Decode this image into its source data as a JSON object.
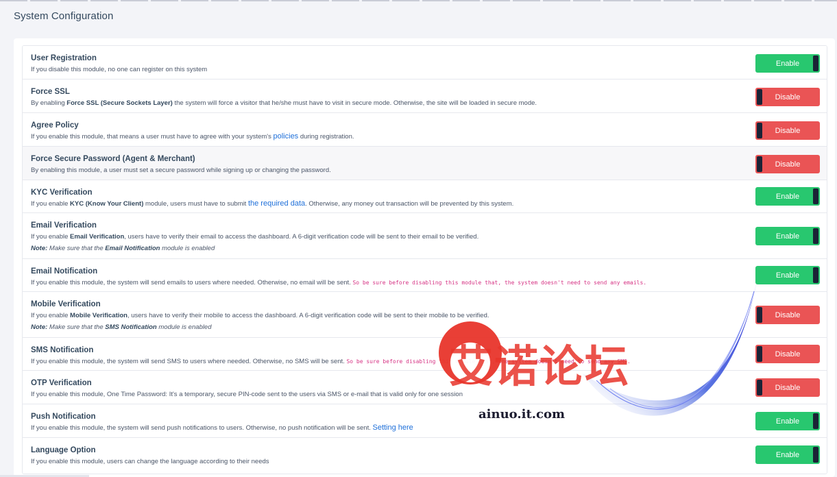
{
  "page": {
    "title": "System Configuration"
  },
  "colors": {
    "enable": "#28c76f",
    "disable": "#ea5455",
    "knob": "#1b2336",
    "link": "#1e6fd9",
    "code": "#d63384"
  },
  "items": [
    {
      "title": "User Registration",
      "desc": "If you disable this module, no one can register on this system",
      "state": "Enable"
    },
    {
      "title": "Force SSL",
      "desc_pre": "By enabling ",
      "desc_bold": "Force SSL (Secure Sockets Layer)",
      "desc_post": " the system will force a visitor that he/she must have to visit in secure mode. Otherwise, the site will be loaded in secure mode.",
      "state": "Disable"
    },
    {
      "title": "Agree Policy",
      "desc_pre": "If you enable this module, that means a user must have to agree with your system's ",
      "desc_link": "policies",
      "desc_post": " during registration.",
      "state": "Disable"
    },
    {
      "title": "Force Secure Password (Agent & Merchant)",
      "desc": "By enabling this module, a user must set a secure password while signing up or changing the password.",
      "state": "Disable"
    },
    {
      "title": "KYC Verification",
      "desc_pre": "If you enable ",
      "desc_bold": "KYC (Know Your Client)",
      "desc_mid": " module, users must have to submit ",
      "desc_link": "the required data",
      "desc_post": ". Otherwise, any money out transaction will be prevented by this system.",
      "state": "Enable"
    },
    {
      "title": "Email Verification",
      "desc_pre": "If you enable ",
      "desc_bold": "Email Verification",
      "desc_post": ", users have to verify their email to access the dashboard. A 6-digit verification code will be sent to their email to be verified.",
      "note_label": "Note:",
      "note_pre": " Make sure that the ",
      "note_bold": "Email Notification",
      "note_post": " module is enabled",
      "state": "Enable"
    },
    {
      "title": "Email Notification",
      "desc": "If you enable this module, the system will send emails to users where needed. Otherwise, no email will be sent. ",
      "desc_code": "So be sure before disabling this module that, the system doesn't need to send any emails.",
      "state": "Enable"
    },
    {
      "title": "Mobile Verification",
      "desc_pre": "If you enable ",
      "desc_bold": "Mobile Verification",
      "desc_post": ", users have to verify their mobile to access the dashboard. A 6-digit verification code will be sent to their mobile to be verified.",
      "note_label": "Note:",
      "note_pre": " Make sure that the ",
      "note_bold": "SMS Notification",
      "note_post": " module is enabled",
      "state": "Disable"
    },
    {
      "title": "SMS Notification",
      "desc": "If you enable this module, the system will send SMS to users where needed. Otherwise, no SMS will be sent. ",
      "desc_code": "So be sure before disabling this module that, the system doesn't need to send any SMS.",
      "state": "Disable"
    },
    {
      "title": "OTP Verification",
      "desc": "If you enable this module, One Time Password: It's a temporary, secure PIN-code sent to the users via SMS or e-mail that is valid only for one session",
      "state": "Disable"
    },
    {
      "title": "Push Notification",
      "desc": "If you enable this module, the system will send push notifications to users. Otherwise, no push notification will be sent. ",
      "desc_link": "Setting here",
      "state": "Enable"
    },
    {
      "title": "Language Option",
      "desc": "If you enable this module, users can change the language according to their needs",
      "state": "Enable"
    }
  ],
  "watermark": {
    "text": "艾诺论坛",
    "domain": "ainuo.it.com"
  }
}
